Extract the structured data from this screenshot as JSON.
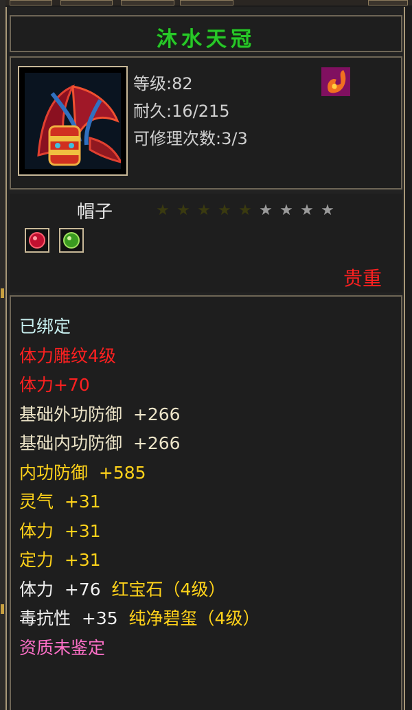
{
  "item": {
    "name": "沐水天冠",
    "level_text": "等级:82",
    "durability_text": "耐久:16/215",
    "repair_text": "可修理次数:3/3",
    "type": "帽子",
    "rarity": "贵重",
    "image_icon": "crown-icon",
    "special_icon": "flame-emblem-icon"
  },
  "stars": {
    "filled": 5,
    "total": 9,
    "filled_color": "#3a3a10",
    "empty_color": "#9a9a9a"
  },
  "gems": [
    {
      "name": "red-gem-icon",
      "color": "#e01030"
    },
    {
      "name": "green-gem-icon",
      "color": "#40b020"
    }
  ],
  "attributes": [
    {
      "text": "已绑定",
      "color": "#c8f0f0"
    },
    {
      "text": "体力雕纹4级",
      "color": "#ff2020"
    },
    {
      "text": "体力+70",
      "color": "#ff2020"
    },
    {
      "text": "基础外功防御  +266",
      "color": "#ece4c8"
    },
    {
      "text": "基础内功防御  +266",
      "color": "#ece4c8"
    },
    {
      "text": "内功防御  +585",
      "color": "#ffd21a"
    },
    {
      "text": "灵气  +31",
      "color": "#ffd21a"
    },
    {
      "text": "体力  +31",
      "color": "#ffd21a"
    },
    {
      "text": "定力  +31",
      "color": "#ffd21a"
    },
    {
      "text": "体力  +76",
      "color": "#f0f0f0",
      "gem_text": "  红宝石（4级）",
      "gem_color": "#ffd21a"
    },
    {
      "text": "毒抗性  +35",
      "color": "#f0f0f0",
      "gem_text": "  纯净碧玺（4级）",
      "gem_color": "#ffd21a"
    },
    {
      "text": "资质未鉴定",
      "color": "#ff70c8"
    }
  ],
  "colors": {
    "title": "#28c828",
    "rarity": "#ff2020",
    "border": "#6e6656"
  }
}
